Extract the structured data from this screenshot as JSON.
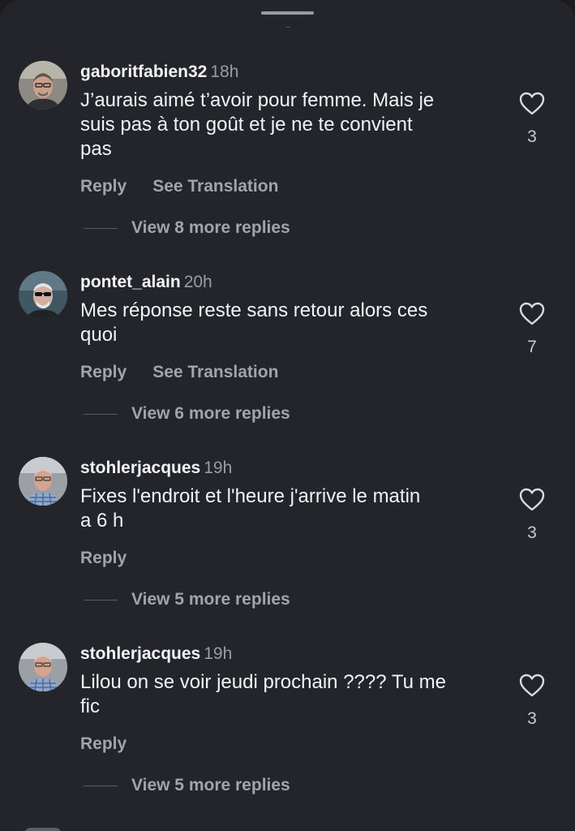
{
  "comments": [
    {
      "username": "gaboritfabien32",
      "time": "18h",
      "text_lines": [
        "J’aurais aimé t’avoir pour femme. Mais je",
        "suis pas à ton goût et je ne te convient",
        "pas"
      ],
      "likes": "3",
      "actions": {
        "reply": "Reply",
        "translate": "See Translation"
      },
      "view_more": "View 8 more replies",
      "avatar_icon": "avatar-man-glasses-icon"
    },
    {
      "username": "pontet_alain",
      "time": "20h",
      "text_lines": [
        "Mes réponse reste sans retour alors ces",
        "quoi"
      ],
      "likes": "7",
      "actions": {
        "reply": "Reply",
        "translate": "See Translation"
      },
      "view_more": "View 6 more replies",
      "avatar_icon": "avatar-man-sunglasses-icon"
    },
    {
      "username": "stohlerjacques",
      "time": "19h",
      "text_lines": [
        "Fixes l'endroit et l'heure j'arrive  le matin",
        "a 6 h"
      ],
      "likes": "3",
      "actions": {
        "reply": "Reply"
      },
      "view_more": "View 5 more replies",
      "avatar_icon": "avatar-man-plaid-shirt-icon"
    },
    {
      "username": "stohlerjacques",
      "time": "19h",
      "text_lines": [
        "Lilou on se voir jeudi prochain ???? Tu me",
        "fic"
      ],
      "likes": "3",
      "actions": {
        "reply": "Reply"
      },
      "view_more": "View 5 more replies",
      "avatar_icon": "avatar-man-plaid-shirt-icon"
    }
  ],
  "colors": {
    "sheet_background": "#24252a",
    "text_primary": "#f2f2f4",
    "text_secondary": "#a3a4ab"
  }
}
